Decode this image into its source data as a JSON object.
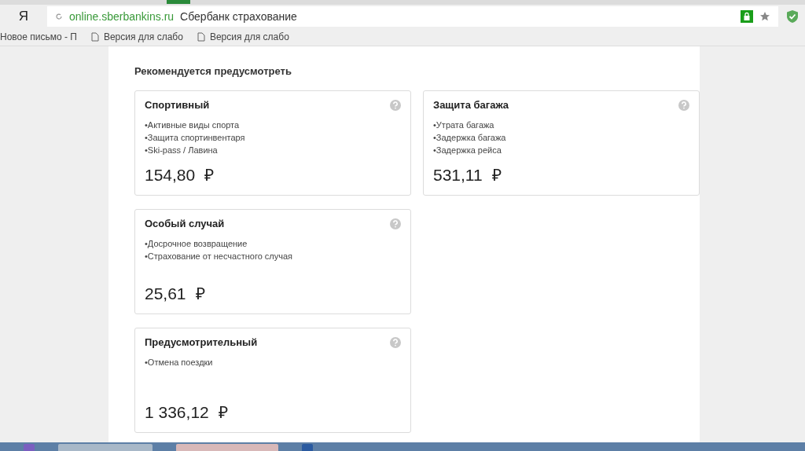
{
  "browser": {
    "logo": "Я",
    "url": "online.sberbankins.ru",
    "title": "Сбербанк страхование"
  },
  "bookmarks": [
    {
      "label": "Новое письмо - П",
      "has_icon": false
    },
    {
      "label": "Версия для слабо",
      "has_icon": true
    },
    {
      "label": "Версия для слабо",
      "has_icon": true
    }
  ],
  "section_title": "Рекомендуется предусмотреть",
  "cards": [
    {
      "title": "Спортивный",
      "features": [
        "•Активные виды спорта",
        "•Защита спортинвентаря",
        "•Ski-pass / Лавина"
      ],
      "price": "154,80",
      "currency": "₽"
    },
    {
      "title": "Защита багажа",
      "features": [
        "•Утрата багажа",
        "•Задержка багажа",
        "•Задержка рейса"
      ],
      "price": "531,11",
      "currency": "₽"
    },
    {
      "title": "Особый случай",
      "features": [
        "•Досрочное возвращение",
        "•Страхование от несчастного случая"
      ],
      "price": "25,61",
      "currency": "₽"
    },
    {
      "title": "Предусмотрительный",
      "features": [
        "•Отмена поездки"
      ],
      "price": "1 336,12",
      "currency": "₽"
    }
  ]
}
